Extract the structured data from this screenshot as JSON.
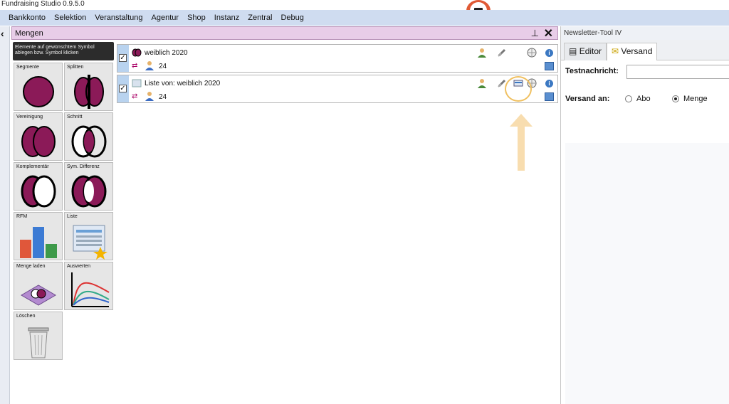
{
  "app": {
    "title": "Fundraising Studio 0.9.5.0"
  },
  "menu": [
    "Bankkonto",
    "Selektion",
    "Veranstaltung",
    "Agentur",
    "Shop",
    "Instanz",
    "Zentral",
    "Debug"
  ],
  "mengen": {
    "title": "Mengen",
    "hint": "Elemente auf gewünschtem Symbol ablegen bzw. Symbol klicken",
    "tools": [
      {
        "label": "Segmente",
        "icon": "segment-icon"
      },
      {
        "label": "Splitten",
        "icon": "split-icon"
      },
      {
        "label": "Vereinigung",
        "icon": "union-icon"
      },
      {
        "label": "Schnitt",
        "icon": "intersection-icon"
      },
      {
        "label": "Komplementär",
        "icon": "complement-icon"
      },
      {
        "label": "Sym. Differenz",
        "icon": "sym-difference-icon"
      },
      {
        "label": "RFM",
        "icon": "bar-chart-icon"
      },
      {
        "label": "Liste",
        "icon": "list-icon"
      },
      {
        "label": "Menge laden",
        "icon": "load-set-icon"
      },
      {
        "label": "Auswerten",
        "icon": "evaluate-chart-icon"
      },
      {
        "label": "Löschen",
        "icon": "trash-icon"
      }
    ],
    "items": [
      {
        "name": "weiblich 2020",
        "count": "24"
      },
      {
        "name": "Liste von: weiblich 2020",
        "count": "24"
      }
    ]
  },
  "newsletter": {
    "title": "Newsletter-Tool IV",
    "tabs": [
      "Editor",
      "Versand"
    ],
    "testnachricht_label": "Testnachricht:",
    "versand_label": "Versand an:",
    "options": [
      "Abo",
      "Menge"
    ],
    "selected": "Menge"
  },
  "colors": {
    "menubar": "#cfdcf0",
    "accent_magenta": "#8b1a58",
    "mengen_header": "#e8cde8",
    "highlight_ring": "#f0c060"
  }
}
